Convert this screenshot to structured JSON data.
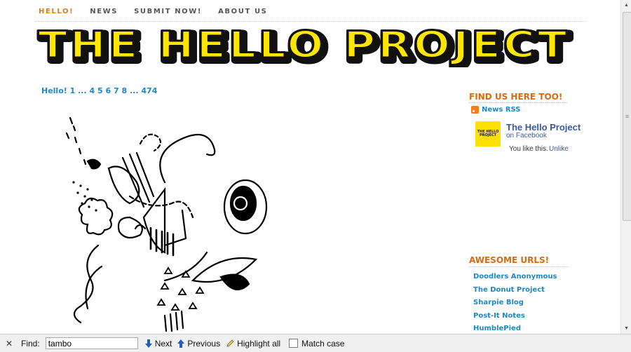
{
  "nav": {
    "items": [
      {
        "label": "HELLO!",
        "active": true
      },
      {
        "label": "NEWS",
        "active": false
      },
      {
        "label": "SUBMIT NOW!",
        "active": false
      },
      {
        "label": "ABOUT US",
        "active": false
      }
    ]
  },
  "banner": {
    "title": "THE HELLO PROJECT",
    "fill_color": "#ffe600",
    "outline_color": "#111111"
  },
  "pager": {
    "label": "Hello!",
    "current": "1",
    "ellipsis1": "...",
    "pages": [
      "4",
      "5",
      "6",
      "7",
      "8"
    ],
    "ellipsis2": "...",
    "last": "474"
  },
  "sidebar": {
    "find_us": {
      "heading": "FIND US HERE TOO!",
      "rss_label": "News RSS"
    },
    "facebook": {
      "logo_text": "THE HELLO PROJECT",
      "title": "The Hello Project",
      "subtitle": "on Facebook",
      "like_text": "You like this.",
      "unlike_label": "Unlike"
    },
    "urls": {
      "heading": "AWESOME URLS!",
      "items": [
        "Doodlers Anonymous",
        "The Donut Project",
        "Sharpie Blog",
        "Post-It Notes",
        "HumblePied"
      ]
    }
  },
  "findbar": {
    "label": "Find:",
    "value": "tambo",
    "next_label": "Next",
    "previous_label": "Previous",
    "highlight_label": "Highlight all",
    "match_case_label": "Match case"
  },
  "colors": {
    "accent_orange": "#d96a10",
    "link_blue": "#1e88c7",
    "facebook_blue": "#3b5998"
  }
}
